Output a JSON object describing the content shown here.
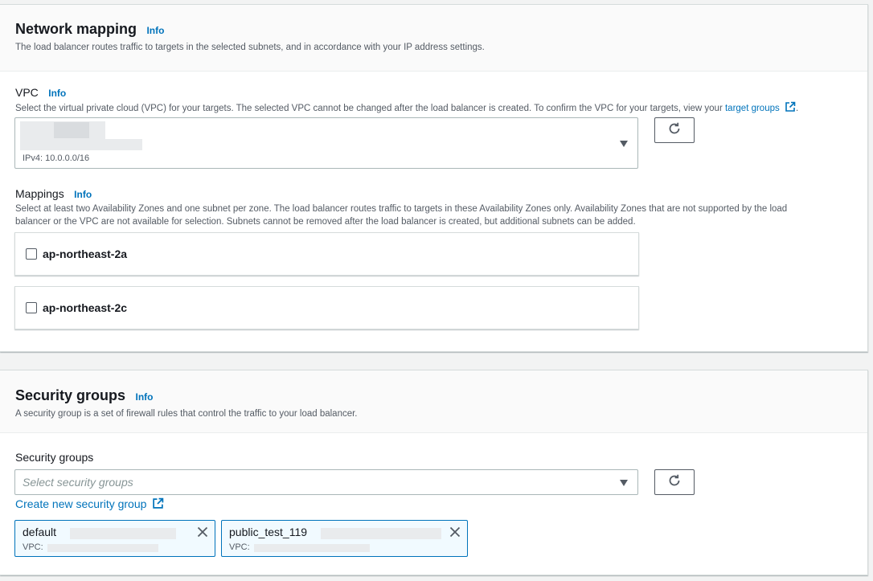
{
  "network_mapping": {
    "title": "Network mapping",
    "info": "Info",
    "description": "The load balancer routes traffic to targets in the selected subnets, and in accordance with your IP address settings.",
    "vpc": {
      "label": "VPC",
      "info": "Info",
      "description": "Select the virtual private cloud (VPC) for your targets. The selected VPC cannot be changed after the load balancer is created. To confirm the VPC for your targets, view your",
      "link_text": "target groups",
      "trailing": ".",
      "ipv4": "IPv4: 10.0.0.0/16"
    },
    "mappings": {
      "label": "Mappings",
      "info": "Info",
      "description_line1": "Select at least two Availability Zones and one subnet per zone. The load balancer routes traffic to targets in these Availability Zones only. Availability Zones that are not supported by the load",
      "description_line2": "balancer or the VPC are not available for selection. Subnets cannot be removed after the load balancer is created, but additional subnets can be added.",
      "zones": [
        "ap-northeast-2a",
        "ap-northeast-2c"
      ]
    }
  },
  "security_groups": {
    "title": "Security groups",
    "info": "Info",
    "description": "A security group is a set of firewall rules that control the traffic to your load balancer.",
    "field_label": "Security groups",
    "placeholder": "Select security groups",
    "create_link": "Create new security group",
    "tokens": [
      {
        "name": "default",
        "sub": "VPC:"
      },
      {
        "name": "public_test_119",
        "sub": "VPC:"
      }
    ]
  },
  "colors": {
    "link": "#0073bb",
    "token_bg": "#f1faff",
    "token_border": "#0073bb"
  }
}
